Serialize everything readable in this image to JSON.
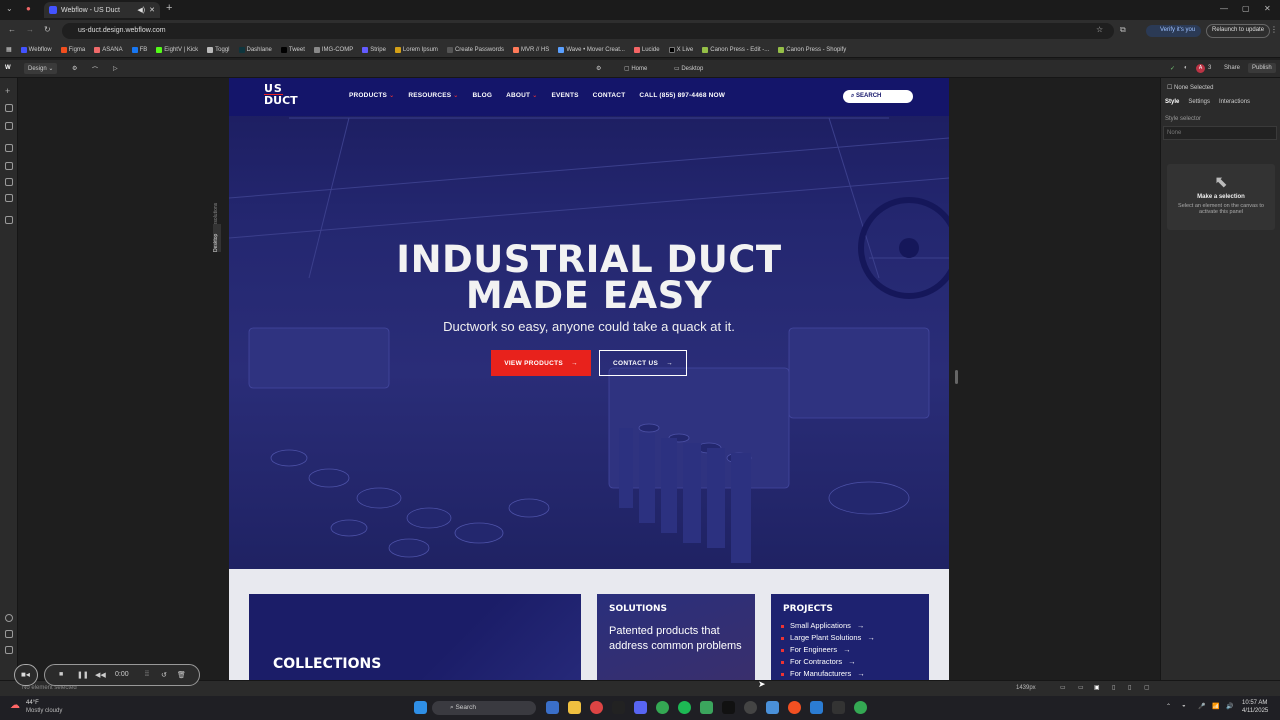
{
  "browser": {
    "tab_title": "Webflow - US Duct",
    "url": "us-duct.design.webflow.com",
    "verify_label": "Verify it's you",
    "relaunch_label": "Relaunch to update",
    "bookmarks": [
      "Webflow",
      "Figma",
      "ASANA",
      "FB",
      "EightV | Kick",
      "Toggl",
      "Dashlane",
      "Tweet",
      "IMG-COMP",
      "Stripe",
      "Lorem Ipsum",
      "Create Passwords",
      "MVR // HS",
      "Wave • Mover Creat...",
      "Lucide",
      "X Live",
      "Canon Press - Edit -...",
      "Canon Press - Shopify"
    ]
  },
  "webflow": {
    "mode_label": "Design",
    "page_label": "Home",
    "breakpoint_label": "Desktop",
    "share_label": "Share",
    "publish_label": "Publish",
    "avatar_initial": "A",
    "collab_count": "3",
    "breakpoint_vertical": "Desktop",
    "affects_label": "Affects all resolutions",
    "right_panel": {
      "none_selected": "None Selected",
      "tabs": [
        "Style",
        "Settings",
        "Interactions"
      ],
      "style_selector_label": "Style selector",
      "style_selector_value": "None",
      "make_selection_title": "Make a selection",
      "make_selection_body": "Select an element on the canvas to activate this panel"
    },
    "bottom": {
      "status": "No element selected",
      "width_label": "1439px"
    }
  },
  "site": {
    "nav": {
      "logo_top": "US",
      "logo_bottom": "DUCT",
      "links": [
        "PRODUCTS",
        "RESOURCES",
        "BLOG",
        "ABOUT",
        "EVENTS",
        "CONTACT",
        "CALL (855) 897-4468 NOW"
      ],
      "search_label": "SEARCH"
    },
    "hero": {
      "title_line1": "INDUSTRIAL DUCT",
      "title_line2": "MADE EASY",
      "subtitle": "Ductwork so easy, anyone could take a quack at it.",
      "primary_button": "VIEW PRODUCTS",
      "secondary_button": "CONTACT US"
    },
    "cards": {
      "collections_title": "COLLECTIONS",
      "solutions_title": "SOLUTIONS",
      "solutions_body": "Patented products that address common problems",
      "projects_title": "PROJECTS",
      "projects_items": [
        "Small Applications",
        "Large Plant Solutions",
        "For Engineers",
        "For Contractors",
        "For Manufacturers"
      ]
    }
  },
  "recorder": {
    "time": "0:00"
  },
  "taskbar": {
    "weather_temp": "44°F",
    "weather_desc": "Mostly cloudy",
    "search_label": "Search",
    "time": "10:57 AM",
    "date": "4/11/2025"
  },
  "colors": {
    "brand_navy": "#14156a",
    "accent_red": "#e8221c"
  }
}
